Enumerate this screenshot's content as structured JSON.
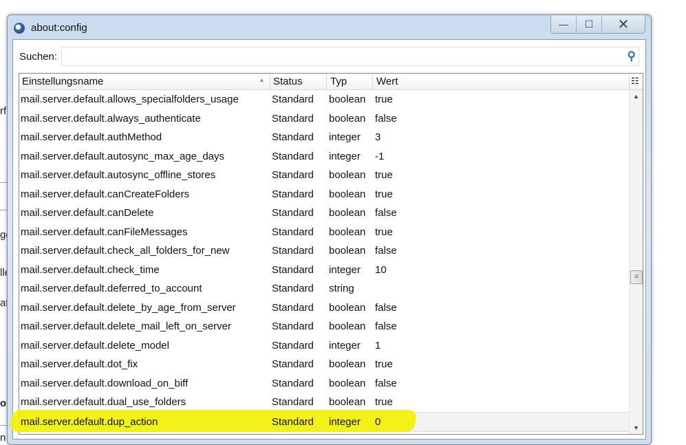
{
  "background_fragments": [
    "rf",
    "ge",
    "lle",
    "at",
    "or",
    "n"
  ],
  "window": {
    "title": "about:config",
    "minimize": "—",
    "maximize": "☐",
    "close": "✕"
  },
  "search": {
    "label": "Suchen:",
    "value": "",
    "placeholder": ""
  },
  "columns": {
    "name": "Einstellungsname",
    "status": "Status",
    "type": "Typ",
    "value": "Wert"
  },
  "rows": [
    {
      "name": "mail.server.default.allows_specialfolders_usage",
      "status": "Standard",
      "type": "boolean",
      "value": "true"
    },
    {
      "name": "mail.server.default.always_authenticate",
      "status": "Standard",
      "type": "boolean",
      "value": "false"
    },
    {
      "name": "mail.server.default.authMethod",
      "status": "Standard",
      "type": "integer",
      "value": "3"
    },
    {
      "name": "mail.server.default.autosync_max_age_days",
      "status": "Standard",
      "type": "integer",
      "value": "-1"
    },
    {
      "name": "mail.server.default.autosync_offline_stores",
      "status": "Standard",
      "type": "boolean",
      "value": "true"
    },
    {
      "name": "mail.server.default.canCreateFolders",
      "status": "Standard",
      "type": "boolean",
      "value": "true"
    },
    {
      "name": "mail.server.default.canDelete",
      "status": "Standard",
      "type": "boolean",
      "value": "false"
    },
    {
      "name": "mail.server.default.canFileMessages",
      "status": "Standard",
      "type": "boolean",
      "value": "true"
    },
    {
      "name": "mail.server.default.check_all_folders_for_new",
      "status": "Standard",
      "type": "boolean",
      "value": "false"
    },
    {
      "name": "mail.server.default.check_time",
      "status": "Standard",
      "type": "integer",
      "value": "10"
    },
    {
      "name": "mail.server.default.deferred_to_account",
      "status": "Standard",
      "type": "string",
      "value": ""
    },
    {
      "name": "mail.server.default.delete_by_age_from_server",
      "status": "Standard",
      "type": "boolean",
      "value": "false"
    },
    {
      "name": "mail.server.default.delete_mail_left_on_server",
      "status": "Standard",
      "type": "boolean",
      "value": "false"
    },
    {
      "name": "mail.server.default.delete_model",
      "status": "Standard",
      "type": "integer",
      "value": "1"
    },
    {
      "name": "mail.server.default.dot_fix",
      "status": "Standard",
      "type": "boolean",
      "value": "true"
    },
    {
      "name": "mail.server.default.download_on_biff",
      "status": "Standard",
      "type": "boolean",
      "value": "false"
    },
    {
      "name": "mail.server.default.dual_use_folders",
      "status": "Standard",
      "type": "boolean",
      "value": "true"
    },
    {
      "name": "mail.server.default.dup_action",
      "status": "Standard",
      "type": "integer",
      "value": "0"
    }
  ],
  "selected_row": 17,
  "highlight_color": "#f2f200"
}
